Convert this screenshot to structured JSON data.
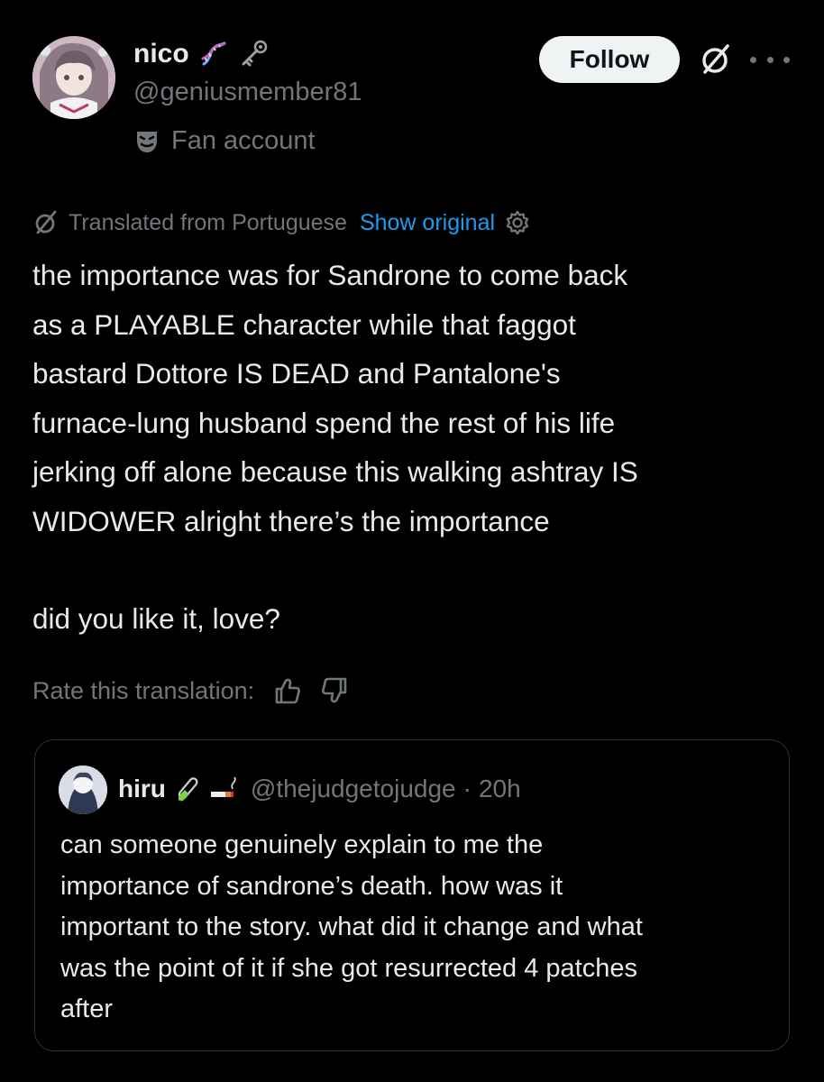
{
  "author": {
    "display_name": "nico",
    "handle": "@geniusmember81",
    "label": "Fan account"
  },
  "actions": {
    "follow_label": "Follow"
  },
  "translation": {
    "translated_from": "Translated from Portuguese",
    "show_original": "Show original",
    "rate_label": "Rate this translation:"
  },
  "tweet": {
    "lines": [
      "the importance was for Sandrone to come back",
      "as a PLAYABLE character while that faggot",
      "bastard Dottore IS DEAD and Pantalone's",
      "furnace-lung husband spend the rest of his life",
      "jerking off alone because this walking ashtray IS",
      "WIDOWER alright there’s the importance",
      "did you like it, love?"
    ]
  },
  "quoted": {
    "display_name": "hiru",
    "handle": "@thejudgetojudge",
    "separator": "·",
    "time": "20h",
    "lines": [
      "can someone genuinely explain to me the",
      "importance of sandrone’s death. how was it",
      "important to the story. what did it change and what",
      "was the point of it if she got resurrected 4 patches",
      "after"
    ]
  },
  "icons": {
    "author_badges": [
      "dna-icon",
      "key-icon"
    ],
    "label_icon": "theater-mask-icon",
    "grok": "grok-icon",
    "more": "more-icon",
    "translate": "grok-icon",
    "settings": "gear-icon",
    "thumbs_up": "thumbs-up-icon",
    "thumbs_down": "thumbs-down-icon",
    "quoted_badges": [
      "test-tube-icon",
      "cigarette-icon"
    ]
  },
  "colors": {
    "background": "#000000",
    "text": "#e7e9ea",
    "muted": "#71767b",
    "link": "#1d9bf0",
    "border": "#2f3336",
    "follow_bg": "#eff3f4"
  }
}
